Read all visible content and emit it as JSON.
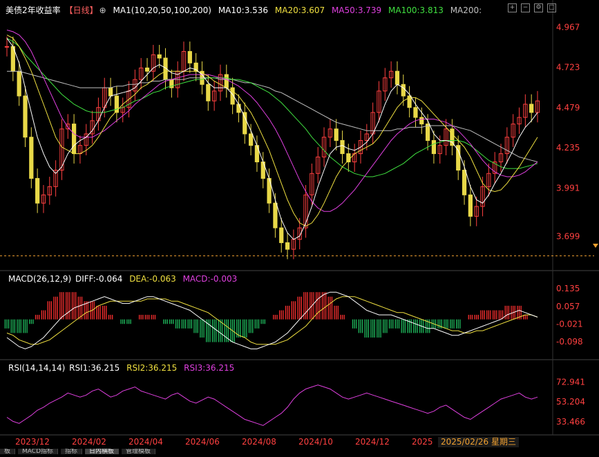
{
  "header": {
    "title": "美债2年收益率",
    "period": "【日线】",
    "ma_label": "MA1(10,20,50,100,200)",
    "ma10": "MA10:3.536",
    "ma20": "MA20:3.607",
    "ma50": "MA50:3.739",
    "ma100": "MA100:3.813",
    "ma200": "MA200:"
  },
  "macd_header": {
    "label": "MACD(26,12,9)",
    "diff": "DIFF:-0.064",
    "dea": "DEA:-0.063",
    "macd": "MACD:-0.003"
  },
  "rsi_header": {
    "label": "RSI(14,14,14)",
    "rsi1": "RSI1:36.215",
    "rsi2": "RSI2:36.215",
    "rsi3": "RSI3:36.215"
  },
  "selected_date": "2025/02/26 星期三",
  "bottom_tabs": [
    "板",
    "MACD指标",
    "指标",
    "日内横板",
    "管理模板"
  ],
  "colors": {
    "up": "#ff4040",
    "down": "#e8d848",
    "ma10": "#ffffff",
    "ma20": "#f0e040",
    "ma50": "#e040e0",
    "ma100": "#40e040",
    "ma200": "#c0c0c0",
    "macd_up": "#ff3030",
    "macd_down": "#20c060",
    "rsi": "#e040e0",
    "axis_text": "#ff4040"
  },
  "chart_data": [
    {
      "type": "line",
      "name_key": "price",
      "y_ticks": [
        4.967,
        4.723,
        4.479,
        4.235,
        3.991,
        3.699
      ],
      "ylim": [
        3.52,
        5.04
      ],
      "reference_line": 3.58,
      "x_ticks": [
        "2023/12",
        "2024/02",
        "2024/04",
        "2024/06",
        "2024/08",
        "2024/10",
        "2024/12",
        "2025"
      ],
      "close": [
        4.85,
        4.7,
        4.55,
        4.3,
        4.05,
        3.9,
        3.95,
        4.0,
        4.1,
        4.35,
        4.38,
        4.2,
        4.25,
        4.32,
        4.4,
        4.48,
        4.6,
        4.55,
        4.45,
        4.48,
        4.58,
        4.65,
        4.72,
        4.7,
        4.8,
        4.78,
        4.65,
        4.6,
        4.7,
        4.82,
        4.75,
        4.7,
        4.62,
        4.52,
        4.58,
        4.68,
        4.6,
        4.5,
        4.45,
        4.32,
        4.25,
        4.15,
        4.05,
        3.9,
        3.75,
        3.66,
        3.62,
        3.68,
        3.75,
        3.95,
        4.08,
        4.18,
        4.3,
        4.35,
        4.28,
        4.2,
        4.15,
        4.2,
        4.28,
        4.32,
        4.45,
        4.58,
        4.66,
        4.7,
        4.62,
        4.55,
        4.48,
        4.42,
        4.38,
        4.28,
        4.2,
        4.25,
        4.35,
        4.25,
        4.1,
        3.95,
        3.82,
        3.88,
        4.0,
        4.08,
        4.15,
        4.2,
        4.3,
        4.38,
        4.42,
        4.5,
        4.45,
        4.52
      ],
      "ma10": [
        4.9,
        4.85,
        4.75,
        4.6,
        4.45,
        4.3,
        4.2,
        4.12,
        4.08,
        4.12,
        4.2,
        4.25,
        4.28,
        4.3,
        4.34,
        4.4,
        4.48,
        4.55,
        4.56,
        4.57,
        4.58,
        4.6,
        4.64,
        4.68,
        4.72,
        4.74,
        4.72,
        4.69,
        4.68,
        4.7,
        4.72,
        4.71,
        4.68,
        4.63,
        4.6,
        4.6,
        4.6,
        4.56,
        4.5,
        4.42,
        4.34,
        4.25,
        4.15,
        4.05,
        3.92,
        3.8,
        3.72,
        3.68,
        3.7,
        3.78,
        3.88,
        4.0,
        4.1,
        4.2,
        4.24,
        4.25,
        4.23,
        4.22,
        4.24,
        4.27,
        4.32,
        4.4,
        4.5,
        4.58,
        4.62,
        4.6,
        4.56,
        4.5,
        4.45,
        4.4,
        4.32,
        4.28,
        4.28,
        4.27,
        4.22,
        4.12,
        4.0,
        3.92,
        3.9,
        3.95,
        4.02,
        4.08,
        4.15,
        4.22,
        4.3,
        4.36,
        4.4,
        4.45
      ],
      "ma20": [
        4.92,
        4.9,
        4.85,
        4.78,
        4.7,
        4.6,
        4.5,
        4.4,
        4.3,
        4.24,
        4.22,
        4.2,
        4.2,
        4.22,
        4.25,
        4.3,
        4.36,
        4.42,
        4.46,
        4.5,
        4.53,
        4.56,
        4.6,
        4.62,
        4.65,
        4.68,
        4.7,
        4.7,
        4.7,
        4.7,
        4.7,
        4.7,
        4.69,
        4.67,
        4.64,
        4.62,
        4.6,
        4.58,
        4.55,
        4.5,
        4.45,
        4.38,
        4.3,
        4.22,
        4.12,
        4.02,
        3.92,
        3.84,
        3.78,
        3.76,
        3.78,
        3.83,
        3.9,
        3.98,
        4.06,
        4.12,
        4.16,
        4.2,
        4.22,
        4.24,
        4.26,
        4.3,
        4.36,
        4.42,
        4.48,
        4.52,
        4.54,
        4.54,
        4.52,
        4.48,
        4.44,
        4.4,
        4.36,
        4.32,
        4.28,
        4.24,
        4.18,
        4.1,
        4.02,
        3.98,
        3.97,
        3.98,
        4.02,
        4.07,
        4.12,
        4.18,
        4.24,
        4.3
      ],
      "ma50": [
        4.95,
        4.94,
        4.92,
        4.88,
        4.82,
        4.74,
        4.66,
        4.58,
        4.5,
        4.42,
        4.36,
        4.32,
        4.3,
        4.3,
        4.3,
        4.32,
        4.34,
        4.37,
        4.4,
        4.43,
        4.46,
        4.5,
        4.53,
        4.56,
        4.59,
        4.62,
        4.64,
        4.65,
        4.66,
        4.67,
        4.68,
        4.68,
        4.68,
        4.68,
        4.67,
        4.66,
        4.65,
        4.63,
        4.61,
        4.58,
        4.55,
        4.51,
        4.46,
        4.41,
        4.35,
        4.28,
        4.2,
        4.12,
        4.04,
        3.97,
        3.91,
        3.87,
        3.85,
        3.85,
        3.87,
        3.9,
        3.94,
        3.98,
        4.03,
        4.08,
        4.13,
        4.18,
        4.23,
        4.28,
        4.32,
        4.35,
        4.38,
        4.4,
        4.41,
        4.41,
        4.41,
        4.4,
        4.39,
        4.37,
        4.34,
        4.3,
        4.26,
        4.21,
        4.16,
        4.12,
        4.09,
        4.07,
        4.06,
        4.06,
        4.07,
        4.09,
        4.12,
        4.15
      ],
      "ma100": [
        4.9,
        4.88,
        4.85,
        4.8,
        4.76,
        4.72,
        4.68,
        4.64,
        4.6,
        4.56,
        4.53,
        4.5,
        4.48,
        4.46,
        4.45,
        4.45,
        4.45,
        4.46,
        4.47,
        4.48,
        4.5,
        4.52,
        4.53,
        4.55,
        4.57,
        4.58,
        4.6,
        4.61,
        4.62,
        4.63,
        4.64,
        4.65,
        4.65,
        4.66,
        4.66,
        4.66,
        4.66,
        4.65,
        4.65,
        4.64,
        4.63,
        4.61,
        4.59,
        4.57,
        4.54,
        4.51,
        4.47,
        4.43,
        4.39,
        4.35,
        4.3,
        4.26,
        4.22,
        4.18,
        4.15,
        4.12,
        4.1,
        4.08,
        4.07,
        4.06,
        4.06,
        4.07,
        4.08,
        4.1,
        4.12,
        4.14,
        4.17,
        4.2,
        4.22,
        4.24,
        4.26,
        4.27,
        4.28,
        4.28,
        4.28,
        4.27,
        4.25,
        4.22,
        4.19,
        4.16,
        4.14,
        4.12,
        4.11,
        4.11,
        4.11,
        4.12,
        4.13,
        4.14
      ],
      "ma200": [
        4.7,
        4.7,
        4.7,
        4.69,
        4.68,
        4.67,
        4.66,
        4.65,
        4.64,
        4.63,
        4.62,
        4.61,
        4.6,
        4.6,
        4.6,
        4.6,
        4.6,
        4.6,
        4.61,
        4.61,
        4.62,
        4.62,
        4.63,
        4.63,
        4.64,
        4.64,
        4.65,
        4.65,
        4.65,
        4.65,
        4.66,
        4.66,
        4.66,
        4.66,
        4.66,
        4.65,
        4.65,
        4.65,
        4.64,
        4.63,
        4.63,
        4.62,
        4.61,
        4.6,
        4.58,
        4.57,
        4.55,
        4.53,
        4.51,
        4.49,
        4.47,
        4.45,
        4.43,
        4.41,
        4.39,
        4.38,
        4.37,
        4.36,
        4.35,
        4.34,
        4.34,
        4.34,
        4.34,
        4.34,
        4.35,
        4.35,
        4.36,
        4.36,
        4.36,
        4.37,
        4.37,
        4.37,
        4.37,
        4.37,
        4.36,
        4.35,
        4.34,
        4.32,
        4.3,
        4.28,
        4.26,
        4.24,
        4.22,
        4.2,
        4.18,
        4.17,
        4.16,
        4.15
      ]
    },
    {
      "type": "bar",
      "name_key": "macd",
      "y_ticks": [
        0.135,
        0.057,
        -0.021,
        -0.098
      ],
      "ylim": [
        -0.15,
        0.16
      ],
      "diff": [
        -0.08,
        -0.1,
        -0.12,
        -0.13,
        -0.12,
        -0.1,
        -0.08,
        -0.05,
        -0.02,
        0.01,
        0.03,
        0.05,
        0.06,
        0.07,
        0.08,
        0.09,
        0.1,
        0.09,
        0.08,
        0.07,
        0.07,
        0.08,
        0.09,
        0.1,
        0.1,
        0.09,
        0.08,
        0.07,
        0.06,
        0.05,
        0.04,
        0.02,
        0.0,
        -0.02,
        -0.04,
        -0.06,
        -0.08,
        -0.1,
        -0.11,
        -0.12,
        -0.13,
        -0.13,
        -0.12,
        -0.11,
        -0.1,
        -0.08,
        -0.06,
        -0.03,
        0.0,
        0.03,
        0.06,
        0.09,
        0.11,
        0.12,
        0.12,
        0.11,
        0.1,
        0.08,
        0.06,
        0.04,
        0.03,
        0.02,
        0.02,
        0.02,
        0.01,
        0.0,
        -0.01,
        -0.02,
        -0.03,
        -0.04,
        -0.04,
        -0.05,
        -0.06,
        -0.07,
        -0.07,
        -0.06,
        -0.05,
        -0.04,
        -0.03,
        -0.02,
        -0.01,
        0.0,
        0.02,
        0.03,
        0.04,
        0.03,
        0.02,
        0.01
      ],
      "dea": [
        -0.06,
        -0.07,
        -0.09,
        -0.1,
        -0.11,
        -0.11,
        -0.1,
        -0.09,
        -0.07,
        -0.05,
        -0.03,
        -0.01,
        0.01,
        0.03,
        0.04,
        0.06,
        0.07,
        0.08,
        0.08,
        0.08,
        0.08,
        0.08,
        0.08,
        0.09,
        0.09,
        0.09,
        0.09,
        0.08,
        0.08,
        0.07,
        0.06,
        0.05,
        0.04,
        0.03,
        0.01,
        -0.01,
        -0.03,
        -0.05,
        -0.07,
        -0.08,
        -0.1,
        -0.11,
        -0.11,
        -0.11,
        -0.11,
        -0.1,
        -0.09,
        -0.07,
        -0.05,
        -0.03,
        0.0,
        0.03,
        0.05,
        0.07,
        0.09,
        0.1,
        0.1,
        0.1,
        0.09,
        0.08,
        0.07,
        0.06,
        0.05,
        0.04,
        0.03,
        0.03,
        0.02,
        0.01,
        0.0,
        -0.01,
        -0.02,
        -0.03,
        -0.04,
        -0.05,
        -0.05,
        -0.06,
        -0.06,
        -0.05,
        -0.05,
        -0.04,
        -0.03,
        -0.02,
        -0.01,
        0.0,
        0.01,
        0.02,
        0.02,
        0.01
      ]
    },
    {
      "type": "line",
      "name_key": "rsi",
      "y_ticks": [
        72.941,
        53.204,
        33.466
      ],
      "ylim": [
        22,
        82
      ],
      "rsi": [
        38,
        34,
        32,
        36,
        40,
        45,
        48,
        52,
        55,
        58,
        62,
        60,
        58,
        60,
        64,
        66,
        62,
        58,
        60,
        64,
        66,
        68,
        64,
        62,
        60,
        58,
        56,
        60,
        62,
        58,
        54,
        52,
        55,
        58,
        56,
        52,
        48,
        44,
        40,
        36,
        34,
        32,
        30,
        34,
        38,
        42,
        48,
        56,
        62,
        66,
        68,
        70,
        68,
        66,
        62,
        58,
        56,
        58,
        60,
        62,
        60,
        58,
        56,
        54,
        52,
        50,
        48,
        46,
        44,
        42,
        44,
        48,
        50,
        46,
        42,
        38,
        36,
        40,
        44,
        48,
        52,
        56,
        58,
        60,
        62,
        58,
        56,
        58
      ]
    }
  ]
}
